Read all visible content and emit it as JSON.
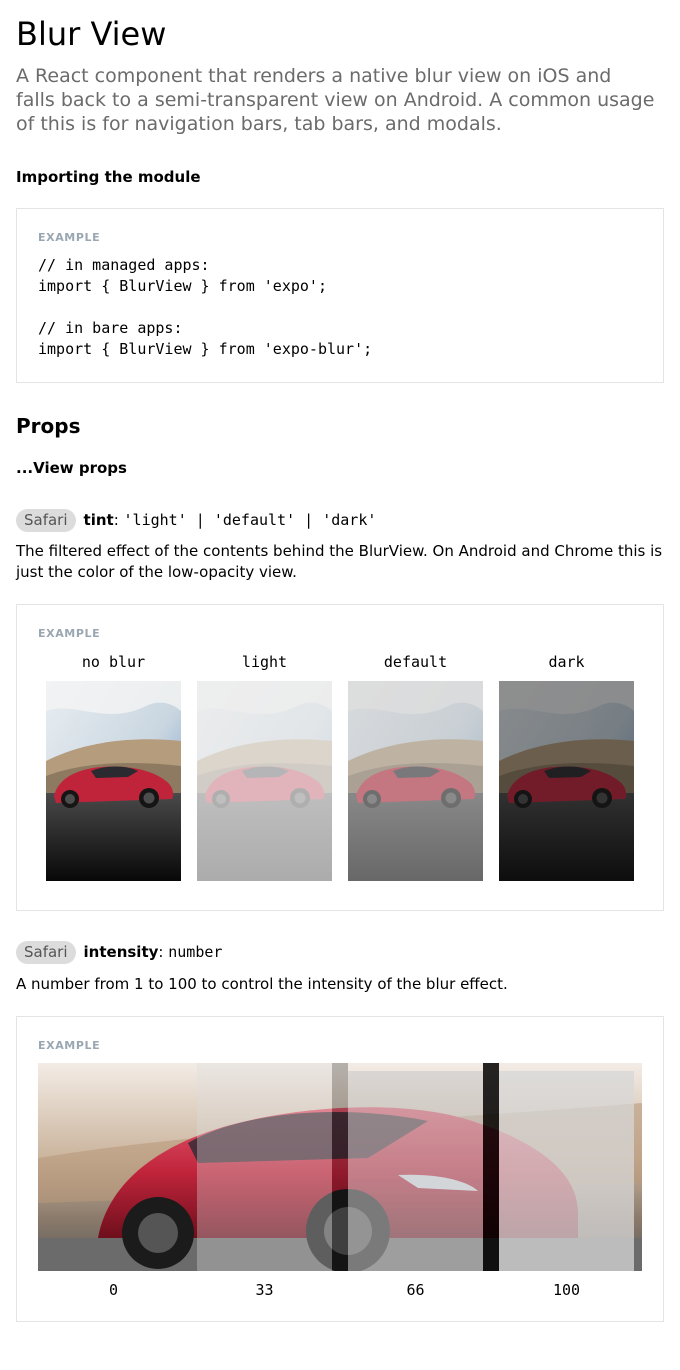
{
  "header": {
    "title": "Blur View",
    "description": "A React component that renders a native blur view on iOS and falls back to a semi-transparent view on Android. A common usage of this is for navigation bars, tab bars, and modals."
  },
  "import_section": {
    "heading": "Importing the module",
    "example_label": "EXAMPLE",
    "code_lines": [
      "// in managed apps:",
      "import { BlurView } from 'expo';",
      "",
      "// in bare apps:",
      "import { BlurView } from 'expo-blur';"
    ]
  },
  "props_section": {
    "heading": "Props",
    "view_props": "...View props"
  },
  "tint_prop": {
    "badge": "Safari",
    "name": "tint",
    "separator": ": ",
    "type": "'light' | 'default' | 'dark'",
    "description": "The filtered effect of the contents behind the BlurView. On Android and Chrome this is just the color of the low-opacity view.",
    "example_label": "EXAMPLE",
    "tiles": [
      {
        "label": "no blur"
      },
      {
        "label": "light"
      },
      {
        "label": "default"
      },
      {
        "label": "dark"
      }
    ]
  },
  "intensity_prop": {
    "badge": "Safari",
    "name": "intensity",
    "separator": ": ",
    "type": "number",
    "description": "A number from 1 to 100 to control the intensity of the blur effect.",
    "example_label": "EXAMPLE",
    "levels": [
      "0",
      "33",
      "66",
      "100"
    ]
  },
  "colors": {
    "car_red": "#c0243b",
    "sky_blue": "#5b8fc4",
    "muted_text": "#6b6b6b",
    "badge_bg": "#dcdcdc",
    "example_label": "#9aa7b2",
    "border": "#e4e4e4"
  }
}
